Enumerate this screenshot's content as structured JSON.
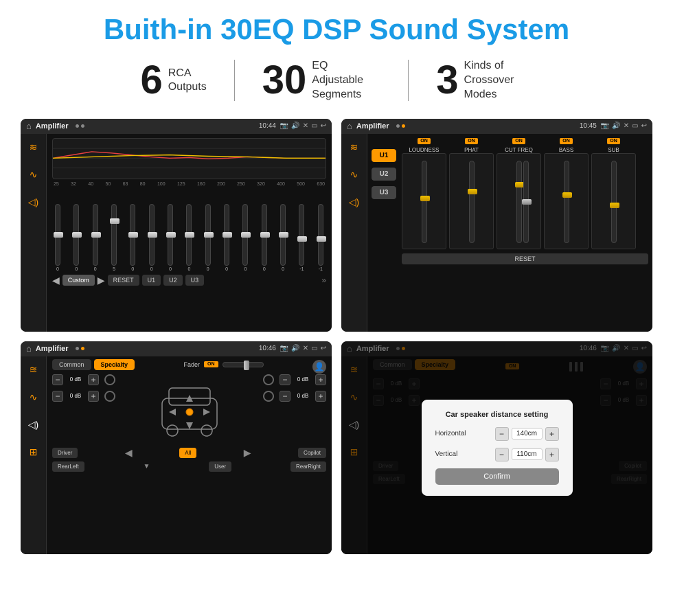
{
  "header": {
    "title": "Buith-in 30EQ DSP Sound System"
  },
  "stats": [
    {
      "number": "6",
      "label": "RCA\nOutputs"
    },
    {
      "number": "30",
      "label": "EQ Adjustable\nSegments"
    },
    {
      "number": "3",
      "label": "Kinds of\nCrossover Modes"
    }
  ],
  "screen1": {
    "title": "Amplifier",
    "time": "10:44",
    "freq_labels": [
      "25",
      "32",
      "40",
      "50",
      "63",
      "80",
      "100",
      "125",
      "160",
      "200",
      "250",
      "320",
      "400",
      "500",
      "630"
    ],
    "slider_values": [
      "0",
      "0",
      "0",
      "5",
      "0",
      "0",
      "0",
      "0",
      "0",
      "0",
      "0",
      "0",
      "0",
      "-1",
      "0",
      "-1"
    ],
    "buttons": [
      "Custom",
      "RESET",
      "U1",
      "U2",
      "U3"
    ]
  },
  "screen2": {
    "title": "Amplifier",
    "time": "10:45",
    "u_buttons": [
      "U1",
      "U2",
      "U3"
    ],
    "cols": [
      {
        "on": true,
        "label": "LOUDNESS"
      },
      {
        "on": true,
        "label": "PHAT"
      },
      {
        "on": true,
        "label": "CUT FREQ"
      },
      {
        "on": true,
        "label": "BASS"
      },
      {
        "on": true,
        "label": "SUB"
      }
    ],
    "reset_label": "RESET"
  },
  "screen3": {
    "title": "Amplifier",
    "time": "10:46",
    "tabs": [
      "Common",
      "Specialty"
    ],
    "fader_label": "Fader",
    "on_label": "ON",
    "vol_rows": [
      "0 dB",
      "0 dB",
      "0 dB",
      "0 dB"
    ],
    "bottom_btns": [
      "Driver",
      "All",
      "Copilot",
      "RearLeft",
      "User",
      "RearRight"
    ]
  },
  "screen4": {
    "title": "Amplifier",
    "time": "10:46",
    "tabs": [
      "Common",
      "Specialty"
    ],
    "on_label": "ON",
    "dialog": {
      "title": "Car speaker distance setting",
      "horizontal_label": "Horizontal",
      "horizontal_value": "140cm",
      "vertical_label": "Vertical",
      "vertical_value": "110cm",
      "confirm_label": "Confirm"
    },
    "vol_rows": [
      "0 dB",
      "0 dB"
    ],
    "bottom_btns": [
      "Driver",
      "Copilot",
      "RearLeft",
      "User",
      "RearRight"
    ]
  }
}
